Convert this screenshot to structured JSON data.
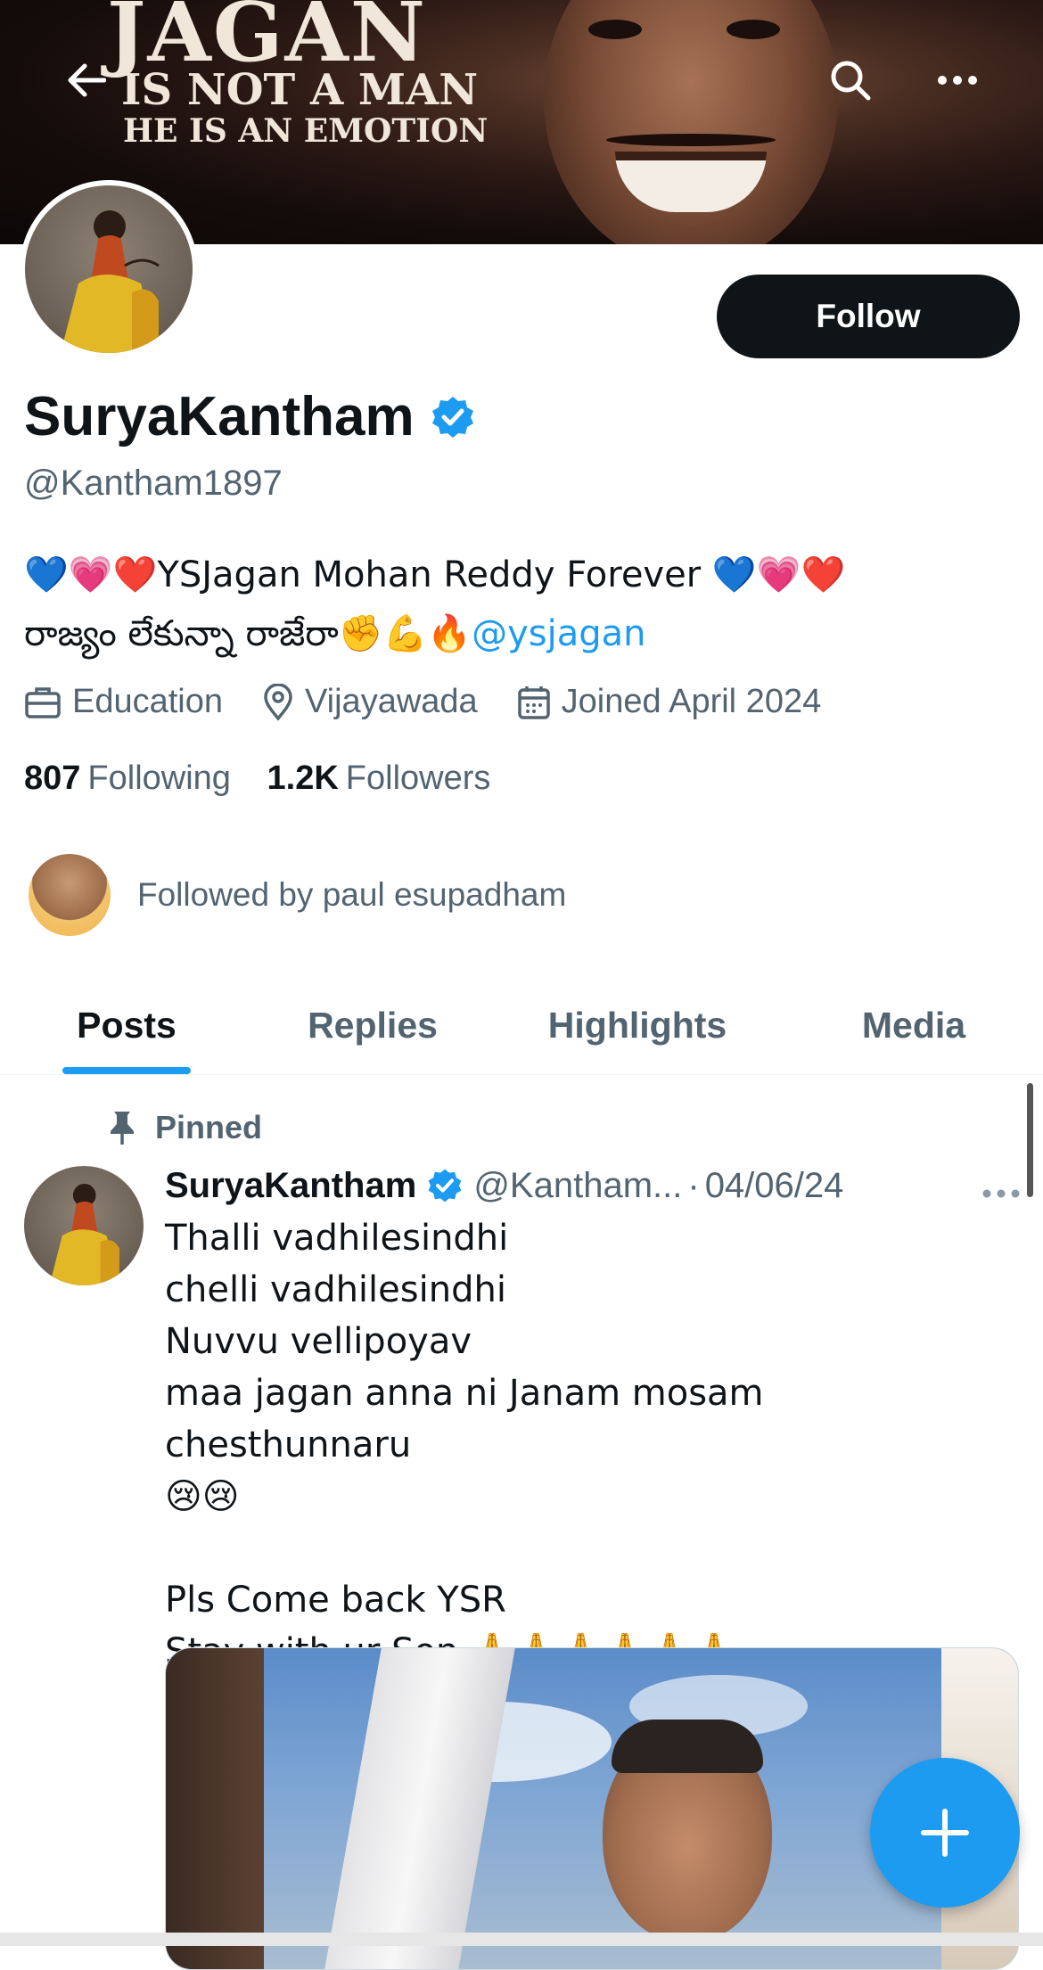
{
  "banner": {
    "title": "JAGAN",
    "line2": "IS NOT A MAN",
    "line3": "HE IS AN EMOTION"
  },
  "header": {
    "back_icon": "arrow-left-icon",
    "search_icon": "search-icon",
    "more_icon": "more-horizontal-icon"
  },
  "profile": {
    "follow_label": "Follow",
    "name": "SuryaKantham",
    "handle": "@Kantham1897",
    "bio_line1": "💙💗❤️YSJagan Mohan Reddy Forever 💙💗❤️",
    "bio_line2_text": "రాజ్యం లేకున్నా రాజేరా✊💪🔥",
    "bio_link": "@ysjagan",
    "category": "Education",
    "location": "Vijayawada",
    "joined": "Joined April 2024",
    "following_count": "807",
    "following_label": "Following",
    "followers_count": "1.2K",
    "followers_label": "Followers",
    "followed_by": "Followed by paul esupadham"
  },
  "tabs": [
    {
      "label": "Posts",
      "active": true
    },
    {
      "label": "Replies",
      "active": false
    },
    {
      "label": "Highlights",
      "active": false
    },
    {
      "label": "Media",
      "active": false
    }
  ],
  "pinned_post": {
    "pinned_label": "Pinned",
    "author_name": "SuryaKantham",
    "author_handle": "@Kantham...",
    "separator": "·",
    "date": "04/06/24",
    "text": "Thalli vadhilesindhi\nchelli vadhilesindhi\nNuvvu vellipoyav\nmaa jagan anna ni Janam mosam chesthunnaru\n😢😢\n\nPls Come back YSR\nStay with ur Son 🙏🙏🙏🙏🙏🙏"
  },
  "fab": {
    "icon": "plus-icon"
  },
  "colors": {
    "accent": "#1d9bf0",
    "text": "#0f1419",
    "secondary": "#536471",
    "follow_bg": "#0f1419"
  }
}
